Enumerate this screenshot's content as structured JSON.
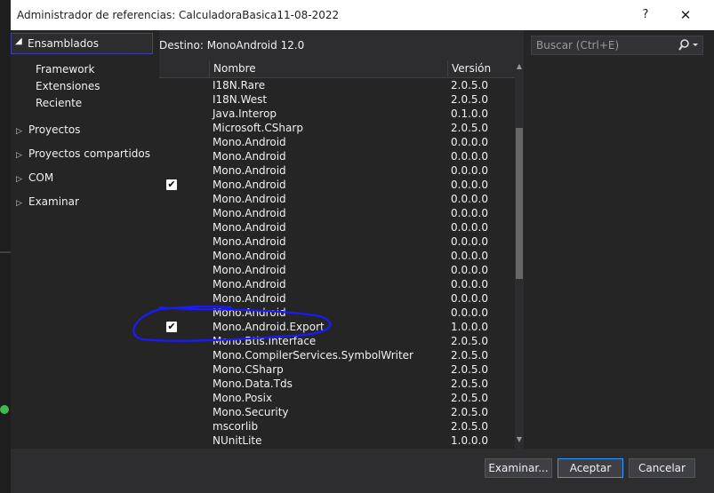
{
  "window": {
    "title": "Administrador de referencias: CalculadoraBasica11-08-2022",
    "help_label": "?",
    "close_label": "✕"
  },
  "sidebar": {
    "selected": {
      "arrow": "◢",
      "label": "Ensamblados"
    },
    "subitems": [
      "Framework",
      "Extensiones",
      "Reciente"
    ],
    "groups": [
      "Proyectos",
      "Proyectos compartidos",
      "COM",
      "Examinar"
    ]
  },
  "target": {
    "label": "Destino: MonoAndroid 12.0"
  },
  "search": {
    "placeholder": "Buscar (Ctrl+E)",
    "icon": "search-icon"
  },
  "table": {
    "columns": [
      "Nombre",
      "Versión"
    ],
    "rows": [
      {
        "checked": false,
        "name": "I18N.Rare",
        "version": "2.0.5.0"
      },
      {
        "checked": false,
        "name": "I18N.West",
        "version": "2.0.5.0"
      },
      {
        "checked": false,
        "name": "Java.Interop",
        "version": "0.1.0.0"
      },
      {
        "checked": false,
        "name": "Microsoft.CSharp",
        "version": "2.0.5.0"
      },
      {
        "checked": false,
        "name": "Mono.Android",
        "version": "0.0.0.0"
      },
      {
        "checked": false,
        "name": "Mono.Android",
        "version": "0.0.0.0"
      },
      {
        "checked": false,
        "name": "Mono.Android",
        "version": "0.0.0.0"
      },
      {
        "checked": true,
        "name": "Mono.Android",
        "version": "0.0.0.0"
      },
      {
        "checked": false,
        "name": "Mono.Android",
        "version": "0.0.0.0"
      },
      {
        "checked": false,
        "name": "Mono.Android",
        "version": "0.0.0.0"
      },
      {
        "checked": false,
        "name": "Mono.Android",
        "version": "0.0.0.0"
      },
      {
        "checked": false,
        "name": "Mono.Android",
        "version": "0.0.0.0"
      },
      {
        "checked": false,
        "name": "Mono.Android",
        "version": "0.0.0.0"
      },
      {
        "checked": false,
        "name": "Mono.Android",
        "version": "0.0.0.0"
      },
      {
        "checked": false,
        "name": "Mono.Android",
        "version": "0.0.0.0"
      },
      {
        "checked": false,
        "name": "Mono.Android",
        "version": "0.0.0.0"
      },
      {
        "checked": false,
        "name": "Mono.Android",
        "version": "0.0.0.0"
      },
      {
        "checked": true,
        "name": "Mono.Android.Export",
        "version": "1.0.0.0"
      },
      {
        "checked": false,
        "name": "Mono.Btls.Interface",
        "version": "2.0.5.0"
      },
      {
        "checked": false,
        "name": "Mono.CompilerServices.SymbolWriter",
        "version": "2.0.5.0"
      },
      {
        "checked": false,
        "name": "Mono.CSharp",
        "version": "2.0.5.0"
      },
      {
        "checked": false,
        "name": "Mono.Data.Tds",
        "version": "2.0.5.0"
      },
      {
        "checked": false,
        "name": "Mono.Posix",
        "version": "2.0.5.0"
      },
      {
        "checked": false,
        "name": "Mono.Security",
        "version": "2.0.5.0"
      },
      {
        "checked": false,
        "name": "mscorlib",
        "version": "2.0.5.0"
      },
      {
        "checked": false,
        "name": "NUnitLite",
        "version": "1.0.0.0"
      }
    ]
  },
  "buttons": {
    "browse": "Examinar...",
    "accept": "Aceptar",
    "cancel": "Cancelar"
  },
  "colors": {
    "accent": "#3399ff",
    "annotation": "#1a1aff"
  }
}
